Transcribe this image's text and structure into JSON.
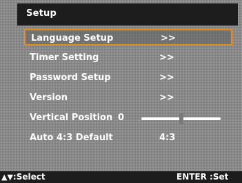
{
  "header": {
    "title": "Setup"
  },
  "menu": {
    "items": [
      {
        "label": "Language Setup",
        "value": ">>"
      },
      {
        "label": "Timer Setting",
        "value": ">>"
      },
      {
        "label": "Password Setup",
        "value": ">>"
      },
      {
        "label": "Version",
        "value": ">>"
      },
      {
        "label": "Vertical Position",
        "value": "0",
        "slider_fraction": 0.5
      },
      {
        "label": "Auto 4:3 Default",
        "value": "4:3"
      }
    ],
    "more_indicator": "down-triangle"
  },
  "footer": {
    "left_icon": "▲▼",
    "left": ":Select",
    "right": "ENTER :Set"
  },
  "colors": {
    "background": "#8a8a8a",
    "bars": "#1d1d1d",
    "selection_border": "#e38b1d",
    "text": "#ffffff"
  }
}
